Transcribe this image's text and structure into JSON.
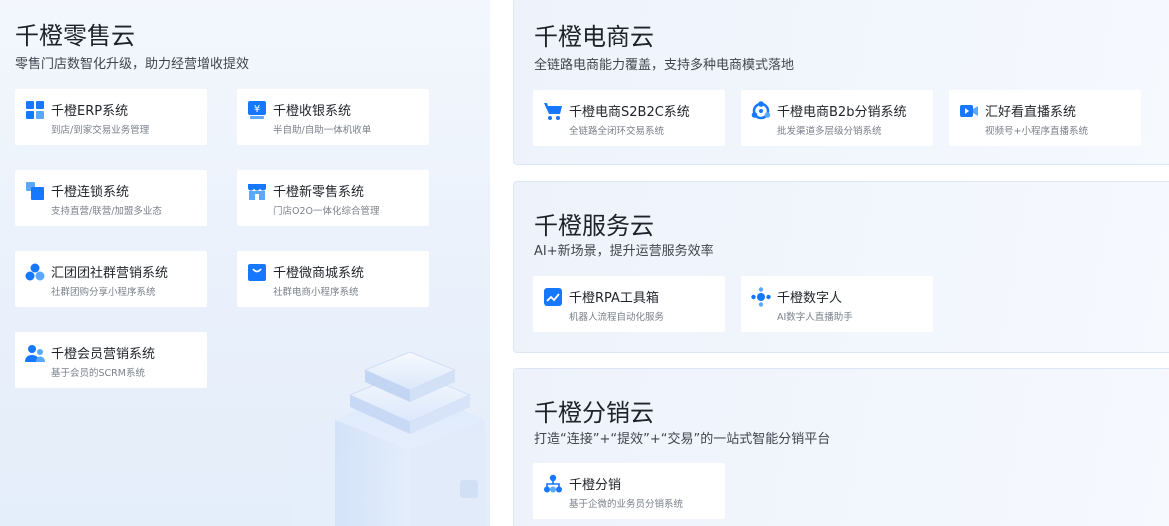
{
  "retail_cloud": {
    "title": "千橙零售云",
    "subtitle": "零售门店数智化升级，助力经营增收提效",
    "cards": [
      {
        "name": "千橙ERP系统",
        "desc": "到店/到家交易业务管理",
        "icon": "grid-icon"
      },
      {
        "name": "千橙收银系统",
        "desc": "半自助/自助一体机收单",
        "icon": "cash-register-icon"
      },
      {
        "name": "千橙连锁系统",
        "desc": "支持直营/联营/加盟多业态",
        "icon": "chain-store-icon"
      },
      {
        "name": "千橙新零售系统",
        "desc": "门店O2O一体化综合管理",
        "icon": "storefront-icon"
      },
      {
        "name": "汇团团社群营销系统",
        "desc": "社群团购分享小程序系统",
        "icon": "community-icon"
      },
      {
        "name": "千橙微商城系统",
        "desc": "社群电商小程序系统",
        "icon": "shopping-bag-icon"
      },
      {
        "name": "千橙会员营销系统",
        "desc": "基于会员的SCRM系统",
        "icon": "members-icon"
      }
    ]
  },
  "ecommerce_cloud": {
    "title": "千橙电商云",
    "subtitle": "全链路电商能力覆盖，支持多种电商模式落地",
    "cards": [
      {
        "name": "千橙电商S2B2C系统",
        "desc": "全链路全闭环交易系统",
        "icon": "shopping-cart-icon"
      },
      {
        "name": "千橙电商B2b分销系统",
        "desc": "批发渠道多层级分销系统",
        "icon": "distribution-network-icon"
      },
      {
        "name": "汇好看直播系统",
        "desc": "视频号+小程序直播系统",
        "icon": "live-video-icon"
      }
    ]
  },
  "service_cloud": {
    "title": "千橙服务云",
    "subtitle": "AI+新场景，提升运营服务效率",
    "cards": [
      {
        "name": "千橙RPA工具箱",
        "desc": "机器人流程自动化服务",
        "icon": "trend-chart-icon"
      },
      {
        "name": "千橙数字人",
        "desc": "AI数字人直播助手",
        "icon": "digital-human-icon"
      }
    ]
  },
  "distribution_cloud": {
    "title": "千橙分销云",
    "subtitle": "打造“连接”+“提效”+“交易”的一站式智能分销平台",
    "cards": [
      {
        "name": "千橙分销",
        "desc": "基于企微的业务员分销系统",
        "icon": "hierarchy-icon"
      }
    ]
  },
  "colors": {
    "accent": "#1677ff",
    "icon_light": "#5aa9ff",
    "card_bg": "#ffffff",
    "panel_bg": "#eef3fb"
  }
}
